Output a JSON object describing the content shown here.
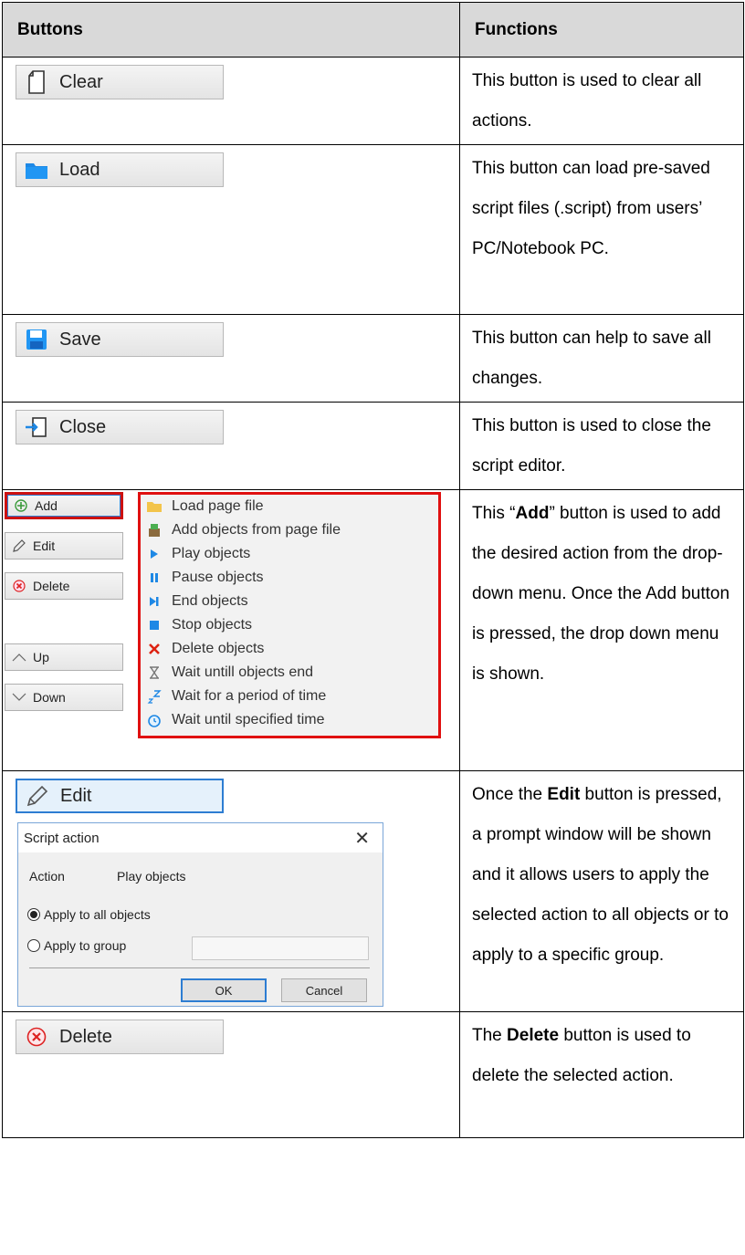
{
  "headers": {
    "buttons": "Buttons",
    "functions": "Functions"
  },
  "rows": [
    {
      "label": "Clear",
      "icon": "document-icon",
      "desc": "This button is used to clear all actions."
    },
    {
      "label": "Load",
      "icon": "folder-icon",
      "desc": "This button can load pre-saved script files (.script) from users’ PC/Notebook PC."
    },
    {
      "label": "Save",
      "icon": "floppy-disk-icon",
      "desc": "This button can help to save all changes."
    },
    {
      "label": "Close",
      "icon": "exit-icon",
      "desc": "This button is used to close the script editor."
    }
  ],
  "add_row": {
    "side_buttons": [
      "Add",
      "Edit",
      "Delete",
      "Up",
      "Down"
    ],
    "menu_items": [
      "Load page file",
      "Add objects from page file",
      "Play objects",
      "Pause objects",
      "End objects",
      "Stop objects",
      "Delete objects",
      "Wait untill objects end",
      "Wait for a period of time",
      "Wait until specified time"
    ],
    "desc_pre": "This “",
    "desc_bold": "Add",
    "desc_post": "” button is used to add the desired action from the drop-down menu. Once the Add button is pressed, the drop down menu is shown."
  },
  "edit_row": {
    "label": "Edit",
    "dialog": {
      "title": "Script action",
      "action_label": "Action",
      "action_value": "Play objects",
      "option_all": "Apply to all objects",
      "option_group": "Apply to group",
      "ok": "OK",
      "cancel": "Cancel"
    },
    "desc_pre": "Once the ",
    "desc_bold": "Edit",
    "desc_post": " button is pressed, a prompt window will be shown and it allows users to apply the selected action to all objects or to apply to a specific group."
  },
  "delete_row": {
    "label": "Delete",
    "desc_pre": "The ",
    "desc_bold": "Delete",
    "desc_post": " button is used to delete the selected action."
  },
  "colors": {
    "header_bg": "#d9d9d9",
    "highlight_red": "#e01010",
    "accent_blue": "#2d7dd2"
  }
}
